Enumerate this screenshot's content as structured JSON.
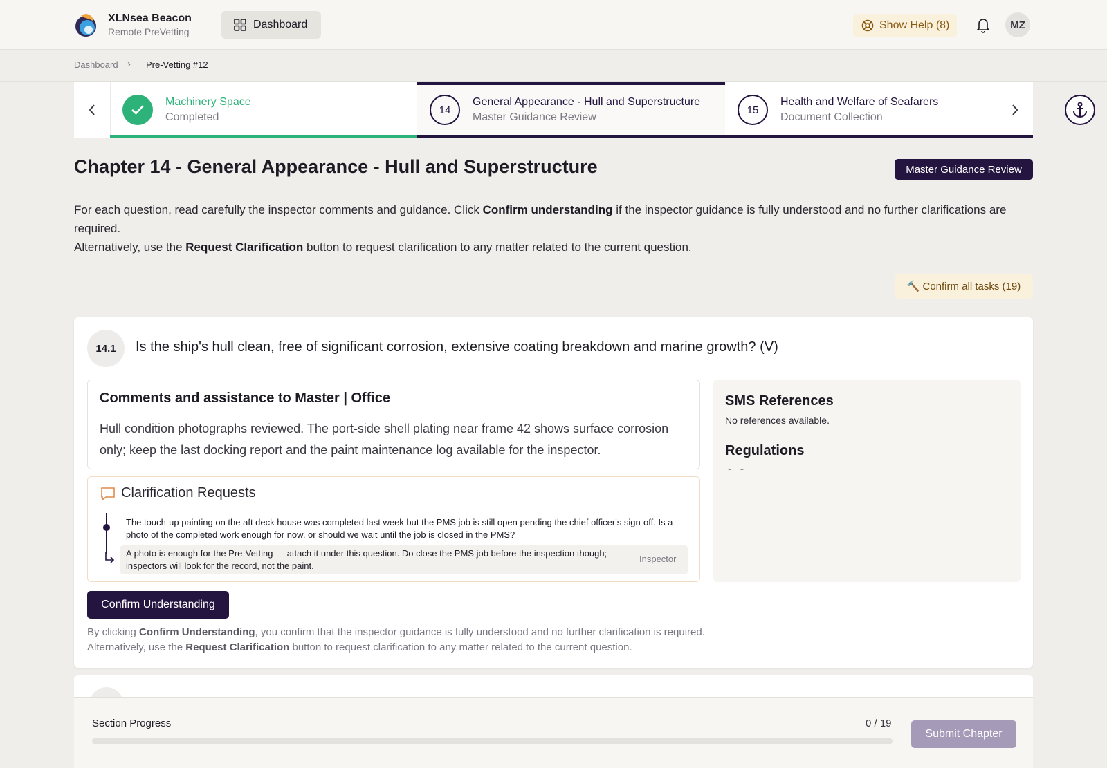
{
  "app": {
    "name": "XLNsea Beacon",
    "subtitle": "Remote PreVetting",
    "dashboard_label": "Dashboard",
    "help_label": "Show Help (8)",
    "avatar_initials": "MZ"
  },
  "breadcrumb": {
    "items": [
      "Dashboard",
      "Pre-Vetting #12"
    ],
    "separator": "›"
  },
  "stepper": {
    "steps": [
      {
        "marker": "✓",
        "title": "Machinery Space",
        "status": "Completed",
        "state": "completed"
      },
      {
        "marker": "14",
        "title": "General Appearance - Hull and Superstructure",
        "status": "Master Guidance Review",
        "state": "active"
      },
      {
        "marker": "15",
        "title": "Health and Welfare of Seafarers",
        "status": "Document Collection",
        "state": "upcoming"
      }
    ]
  },
  "chapter": {
    "title": "Chapter 14 - General Appearance - Hull and Superstructure",
    "badge": "Master Guidance Review",
    "intro": {
      "p1_a": "For each question, read carefully the inspector comments and guidance. Click ",
      "p1_b": "Confirm understanding",
      "p1_c": " if the inspector guidance is fully understood and no further clarifications are required.",
      "p2_a": "Alternatively, use the ",
      "p2_b": "Request Clarification",
      "p2_c": " button to request clarification to any matter related to the current question."
    },
    "confirm_all_label": "Confirm all tasks (19)"
  },
  "question": {
    "number": "14.1",
    "text": "Is the ship's hull clean, free of significant corrosion, extensive coating breakdown and marine growth? (V)",
    "comments_title": "Comments and assistance to Master | Office",
    "comments_body": "Hull condition photographs reviewed. The port-side shell plating near frame 42 shows surface corrosion only; keep the last docking report and the paint maintenance log available for the inspector.",
    "clarification_title": "Clarification Requests",
    "clarification_message": "The touch-up painting on the aft deck house was completed last week but the PMS job is still open pending the chief officer's sign-off. Is a photo of the completed work enough for now, or should we wait until the job is closed in the PMS?",
    "clarification_reply": "A photo is enough for the Pre-Vetting — attach it under this question. Do close the PMS job before the inspection though; inspectors will look for the record, not the paint.",
    "reply_role": "Inspector",
    "sms_title": "SMS References",
    "sms_value": "No references available.",
    "regulations_title": "Regulations",
    "regulations_value": "- -",
    "confirm_label": "Confirm Understanding",
    "footnote": {
      "l1_a": "By clicking ",
      "l1_b": "Confirm Understanding",
      "l1_c": ", you confirm that the inspector guidance is fully understood and no further clarification is required.",
      "l2_a": "Alternatively, use the ",
      "l2_b": "Request Clarification",
      "l2_c": " button to request clarification to any matter related to the current question."
    }
  },
  "progress": {
    "label": "Section Progress",
    "count": "0 / 19",
    "fraction": 0,
    "submit_label": "Submit Chapter"
  },
  "colors": {
    "primary": "#231440",
    "success": "#2db37a",
    "warning_bg": "#faf1dc"
  },
  "icons": {
    "dashboard": "grid-icon",
    "help": "lifebuoy-icon",
    "notifications": "bell-icon",
    "anchor": "anchor-icon",
    "clarification": "chat-icon"
  }
}
